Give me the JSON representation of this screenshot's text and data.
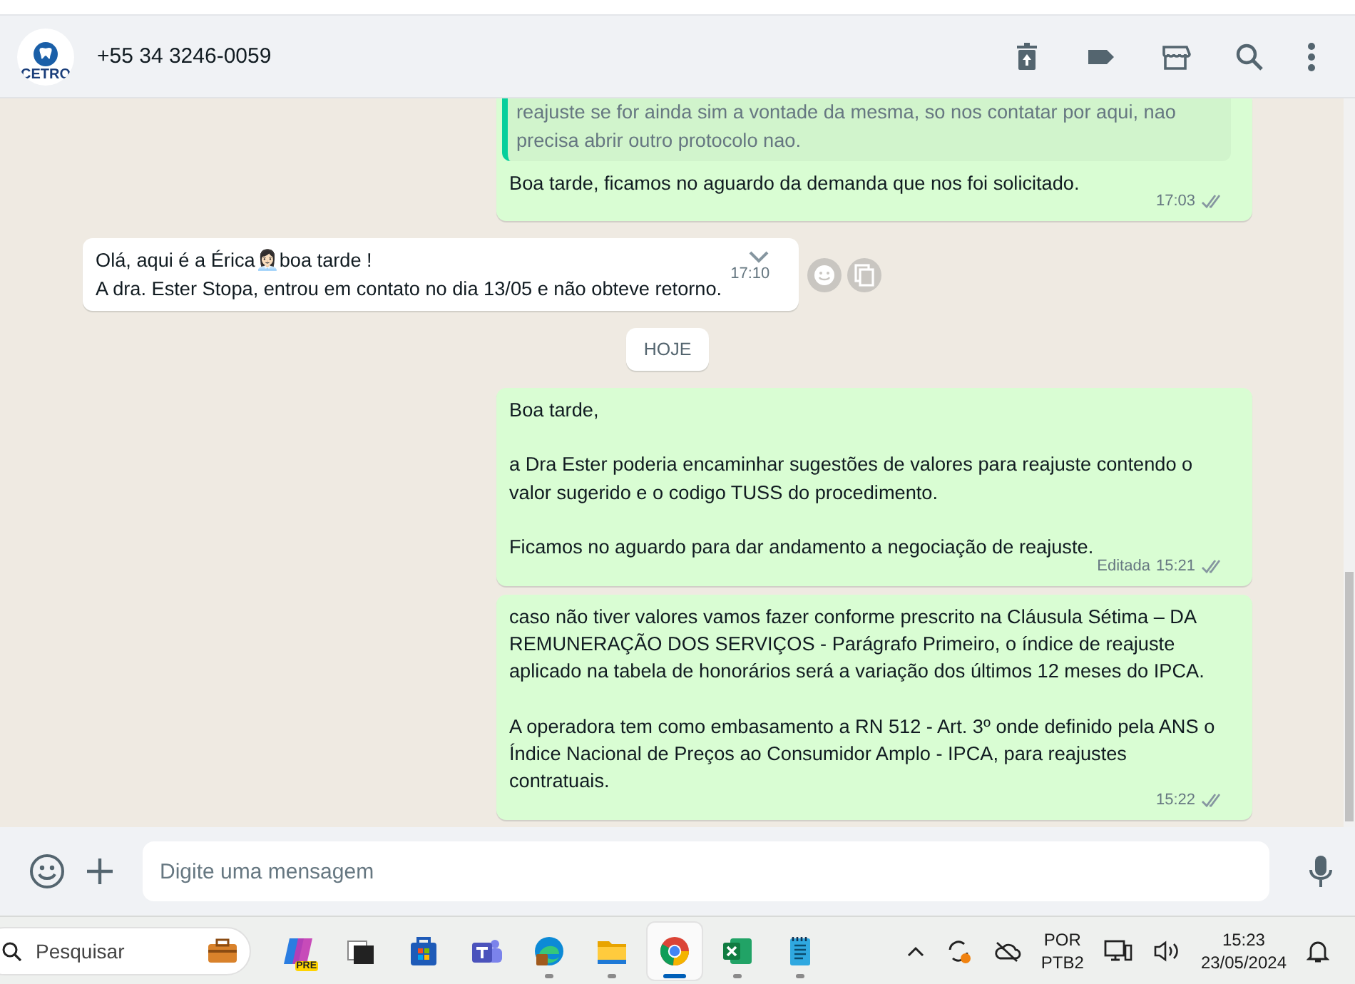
{
  "header": {
    "logo_text": "CETRO",
    "contact": "+55 34 3246-0059",
    "actions": [
      {
        "kind": "delete"
      },
      {
        "kind": "label"
      },
      {
        "kind": "store"
      },
      {
        "kind": "search"
      },
      {
        "kind": "menu"
      }
    ]
  },
  "messages": [
    {
      "kind": "outgoing",
      "quote": "reajuste se for ainda sim a vontade da mesma, so nos contatar por aqui, nao precisa abrir outro protocolo nao.",
      "text": "Boa tarde, ficamos no aguardo da demanda que nos foi solicitado.",
      "time": "17:03"
    },
    {
      "kind": "incoming",
      "text": "Olá, aqui é a Érica👩🏻‍💼boa tarde !\nA dra. Ester Stopa, entrou em contato no dia 13/05 e não obteve retorno.",
      "time": "17:10"
    },
    {
      "kind": "date",
      "text": "HOJE"
    },
    {
      "kind": "outgoing",
      "text": "Boa tarde,\n\na Dra Ester poderia encaminhar sugestões de valores para reajuste contendo o valor sugerido e o codigo TUSS do procedimento.\n\nFicamos no aguardo para dar andamento a negociação de reajuste.",
      "edited_label": "Editada",
      "time": "15:21"
    },
    {
      "kind": "outgoing",
      "text": "caso não tiver valores vamos fazer conforme prescrito na Cláusula Sétima – DA REMUNERAÇÃO DOS SERVIÇOS - Parágrafo Primeiro, o índice de reajuste aplicado na tabela de honorários será a variação dos últimos 12 meses do IPCA.\n\nA operadora tem como embasamento a RN 512 - Art. 3º onde definido pela ANS o Índice Nacional de Preços ao Consumidor Amplo - IPCA, para reajustes contratuais.",
      "time": "15:22"
    }
  ],
  "composer": {
    "placeholder": "Digite uma mensagem"
  },
  "taskbar": {
    "search_placeholder": "Pesquisar",
    "apps": [
      {
        "kind": "copilot",
        "badge": "PRE",
        "selected": false,
        "running": false
      },
      {
        "kind": "windows",
        "selected": false,
        "running": false
      },
      {
        "kind": "store",
        "selected": false,
        "running": false
      },
      {
        "kind": "teams",
        "selected": false,
        "running": false
      },
      {
        "kind": "edge",
        "selected": false,
        "running": true
      },
      {
        "kind": "folder",
        "selected": false,
        "running": true
      },
      {
        "kind": "chrome",
        "selected": true,
        "running": true
      },
      {
        "kind": "excel",
        "selected": false,
        "running": true
      },
      {
        "kind": "notepad",
        "selected": false,
        "running": true
      }
    ],
    "language": "POR",
    "layout": "PTB2",
    "time": "15:23",
    "date": "23/05/2024"
  }
}
